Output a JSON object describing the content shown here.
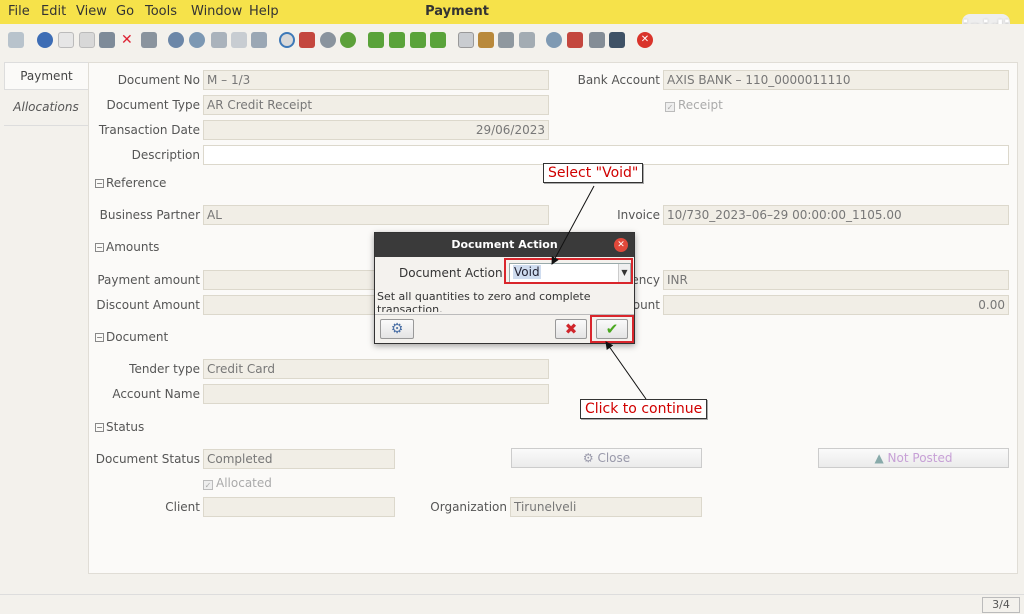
{
  "menu": {
    "items": [
      "File",
      "Edit",
      "View",
      "Go",
      "Tools",
      "Window",
      "Help"
    ],
    "window_title": "Payment"
  },
  "logo_text": "jaidi",
  "toolbar_icons": [
    "undo-icon",
    "help-icon",
    "new-icon",
    "copy-icon",
    "save-icon",
    "delete-icon",
    "save-disk-icon",
    "refresh-icon",
    "find-icon",
    "attachment-icon",
    "chat-icon",
    "grid-toggle-icon",
    "history-icon",
    "home-icon",
    "previous-icon",
    "next-icon",
    "first-record-icon",
    "previous-record-icon",
    "next-record-icon",
    "last-record-icon",
    "report-icon",
    "archive-icon",
    "print-icon",
    "print-preview-icon",
    "zoom-across-icon",
    "workflow-icon",
    "product-info-icon",
    "request-icon",
    "exit-icon"
  ],
  "tabs": {
    "payment": "Payment",
    "allocations": "Allocations"
  },
  "form": {
    "document_no": {
      "label": "Document No",
      "value": "M – 1/3"
    },
    "bank_account": {
      "label": "Bank Account",
      "value": "AXIS BANK – 110_0000011110"
    },
    "document_type": {
      "label": "Document Type",
      "value": "AR Credit Receipt"
    },
    "receipt": {
      "label": "Receipt"
    },
    "transaction_date": {
      "label": "Transaction Date",
      "value": "29/06/2023"
    },
    "description": {
      "label": "Description",
      "value": ""
    },
    "reference_section": "Reference",
    "business_partner": {
      "label": "Business Partner",
      "value": "AL"
    },
    "invoice": {
      "label": "Invoice",
      "value": "10/730_2023–06–29 00:00:00_1105.00"
    },
    "amounts_section": "Amounts",
    "payment_amount": {
      "label": "Payment amount",
      "value": ""
    },
    "currency": {
      "label_visible": "ency",
      "value": "INR"
    },
    "discount_amount": {
      "label": "Discount Amount",
      "value": ""
    },
    "writeoff": {
      "label_visible": "ount",
      "value": "0.00"
    },
    "document_section": "Document",
    "tender_type": {
      "label": "Tender type",
      "value": "Credit Card"
    },
    "account_name": {
      "label": "Account Name",
      "value": ""
    },
    "status_section": "Status",
    "document_status": {
      "label": "Document Status",
      "value": "Completed"
    },
    "close_button": "Close",
    "not_posted_button": "Not Posted",
    "allocated": {
      "label": "Allocated"
    },
    "client": {
      "label": "Client",
      "value": ""
    },
    "organization": {
      "label": "Organization",
      "value": "Tirunelveli"
    }
  },
  "dialog": {
    "title": "Document Action",
    "label": "Document Action",
    "selected": "Void",
    "description": "Set all quantities to zero and complete transaction."
  },
  "annotations": {
    "select_void": "Select \"Void\"",
    "click_continue": "Click to continue"
  },
  "status": {
    "pager": "3/4"
  },
  "colors": {
    "menubar": "#f6e24a",
    "annotation_red": "#d9262c",
    "ok_green": "#4aa820",
    "cancel_red": "#d0262c"
  }
}
